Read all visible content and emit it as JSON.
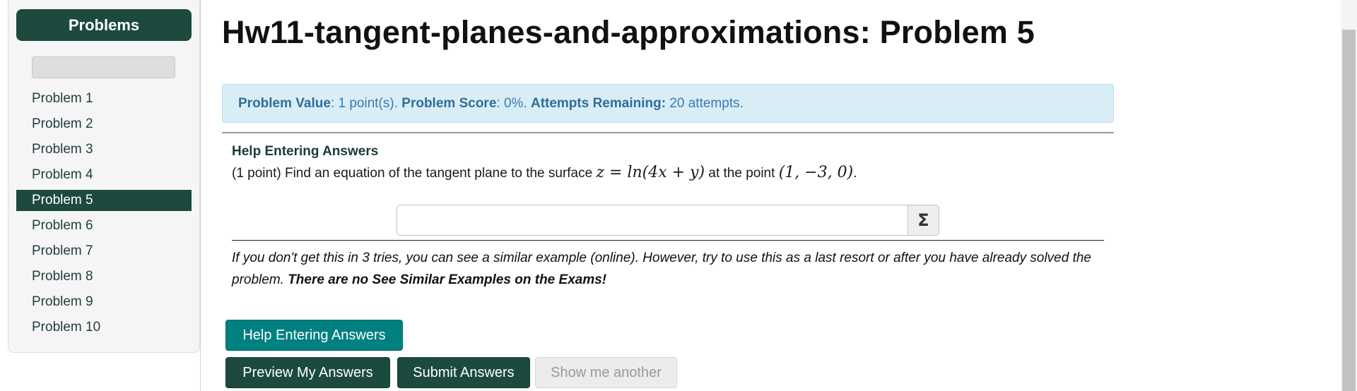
{
  "sidebar": {
    "title": "Problems",
    "items": [
      {
        "label": "Problem 1"
      },
      {
        "label": "Problem 2"
      },
      {
        "label": "Problem 3"
      },
      {
        "label": "Problem 4"
      },
      {
        "label": "Problem 5"
      },
      {
        "label": "Problem 6"
      },
      {
        "label": "Problem 7"
      },
      {
        "label": "Problem 8"
      },
      {
        "label": "Problem 9"
      },
      {
        "label": "Problem 10"
      }
    ],
    "active_label": "Problem 5"
  },
  "main": {
    "title": "Hw11-tangent-planes-and-approximations: Problem 5",
    "score": {
      "value_label": "Problem Value",
      "value_text": ": 1 point(s). ",
      "score_label": "Problem Score",
      "score_text": ": 0%. ",
      "attempts_label": "Attempts Remaining:",
      "attempts_text": " 20 attempts."
    },
    "problem": {
      "help_heading": "Help Entering Answers",
      "prefix": "(1 point) Find an equation of the tangent plane to the surface ",
      "equation": "z = ln(4x + y)",
      "middle": " at the point ",
      "point": "(1, −3, 0)",
      "suffix": "."
    },
    "answer": {
      "value": "",
      "sigma_label": "Σ"
    },
    "note": {
      "text": "If you don't get this in 3 tries, you can see a similar example (online). However, try to use this as a last resort or after you have already solved the problem. ",
      "bold": "There are no See Similar Examples on the Exams!"
    },
    "buttons": {
      "help": "Help Entering Answers",
      "preview": "Preview My Answers",
      "submit": "Submit Answers",
      "another": "Show me another"
    }
  },
  "colors": {
    "brand_dark": "#1c4a3e",
    "teal": "#008080",
    "info_bg": "#d9edf7",
    "info_text": "#3a7bae"
  }
}
